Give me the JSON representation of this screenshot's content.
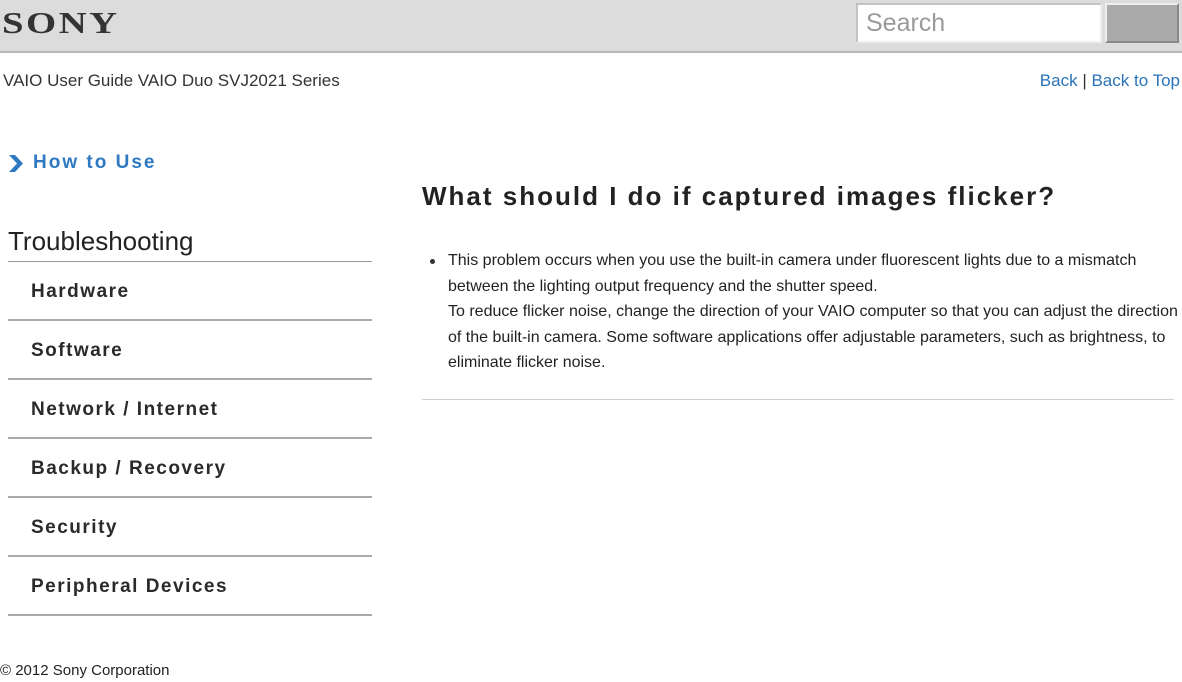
{
  "header": {
    "logo": "SONY",
    "search": {
      "placeholder": "Search",
      "value": ""
    },
    "search_button_label": ""
  },
  "subheader": {
    "guide_title": "VAIO User Guide VAIO Duo SVJ2021 Series",
    "links": {
      "back": "Back",
      "separator": "|",
      "back_to_top": "Back to Top"
    }
  },
  "sidebar": {
    "how_to_use": "How to Use",
    "section_title": "Troubleshooting",
    "items": [
      {
        "label": "Hardware"
      },
      {
        "label": "Software"
      },
      {
        "label": "Network / Internet"
      },
      {
        "label": "Backup / Recovery"
      },
      {
        "label": "Security"
      },
      {
        "label": "Peripheral Devices"
      }
    ]
  },
  "article": {
    "title": "What should I do if captured images flicker?",
    "bullets": [
      {
        "line1": "This problem occurs when you use the built-in camera under fluorescent lights due to a mismatch between the lighting output frequency and the shutter speed.",
        "line2": "To reduce flicker noise, change the direction of your VAIO computer so that you can adjust the direction of the built-in camera. Some software applications offer adjustable parameters, such as brightness, to eliminate flicker noise."
      }
    ]
  },
  "footer": {
    "copyright": "© 2012 Sony Corporation"
  },
  "colors": {
    "link": "#2a73b8",
    "accent": "#2f79c3",
    "header_bg": "#dcdcdc"
  }
}
